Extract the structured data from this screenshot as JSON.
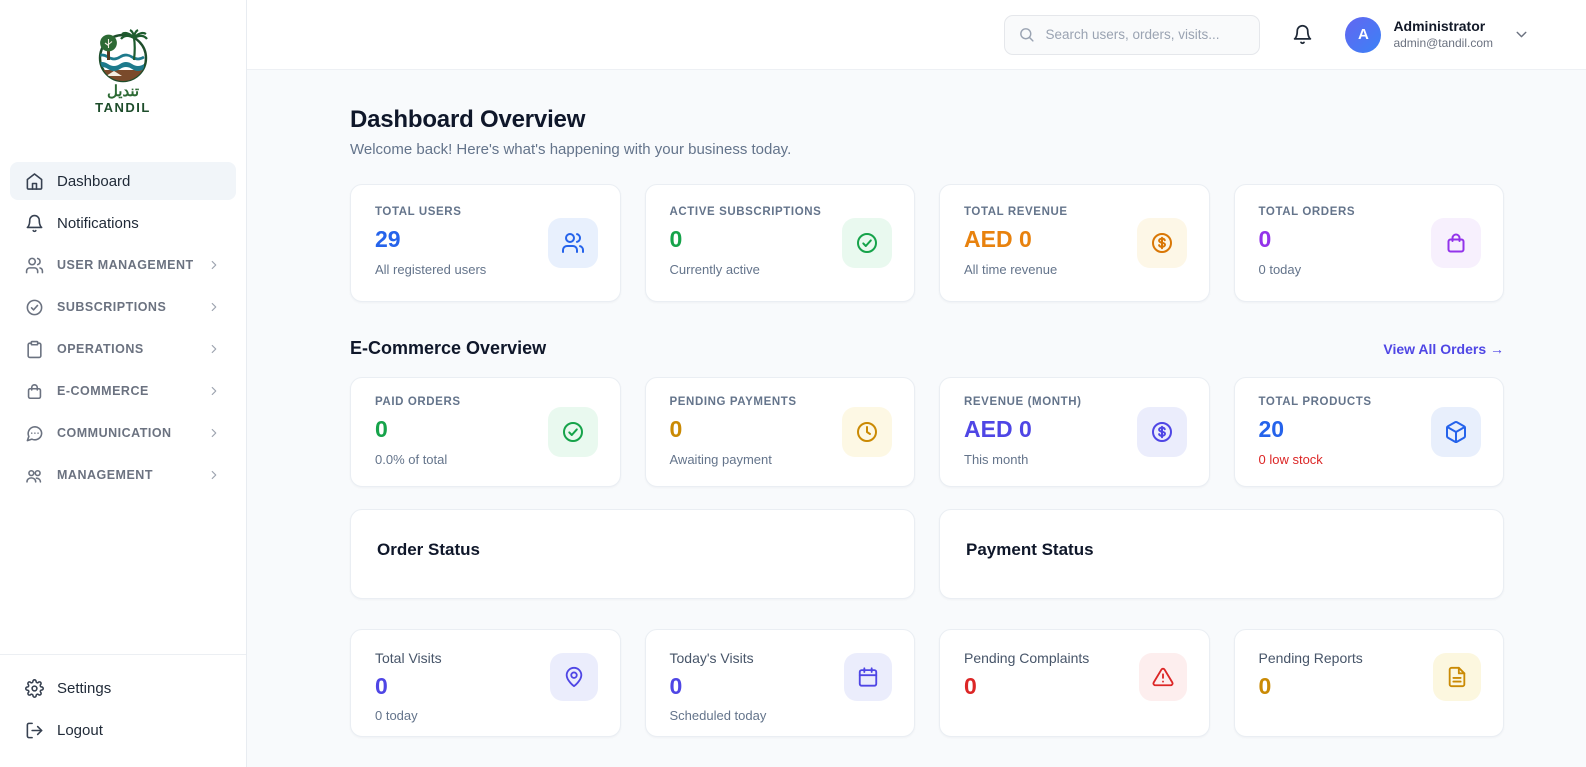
{
  "brand": {
    "name_en": "TANDIL",
    "name_ar": "تنديل"
  },
  "header": {
    "search_placeholder": "Search users, orders, visits...",
    "user": {
      "name": "Administrator",
      "email": "admin@tandil.com",
      "avatar_initial": "A"
    }
  },
  "sidebar": {
    "items": [
      {
        "label": "Dashboard",
        "icon": "home-icon",
        "active": true
      },
      {
        "label": "Notifications",
        "icon": "bell-icon",
        "active": false
      },
      {
        "label": "USER MANAGEMENT",
        "icon": "users-icon",
        "expandable": true
      },
      {
        "label": "SUBSCRIPTIONS",
        "icon": "check-circle-icon",
        "expandable": true
      },
      {
        "label": "OPERATIONS",
        "icon": "clipboard-icon",
        "expandable": true
      },
      {
        "label": "E-COMMERCE",
        "icon": "shopping-bag-icon",
        "expandable": true
      },
      {
        "label": "COMMUNICATION",
        "icon": "chat-icon",
        "expandable": true
      },
      {
        "label": "MANAGEMENT",
        "icon": "team-icon",
        "expandable": true
      }
    ],
    "footer_items": [
      {
        "label": "Settings",
        "icon": "gear-icon"
      },
      {
        "label": "Logout",
        "icon": "logout-icon"
      }
    ]
  },
  "page": {
    "title": "Dashboard Overview",
    "subtitle": "Welcome back! Here's what's happening with your business today."
  },
  "overview_cards": [
    {
      "label": "TOTAL USERS",
      "value": "29",
      "sub": "All registered users",
      "icon": "users-icon",
      "value_color": "#2563eb",
      "icon_color": "#2563eb",
      "icon_bg": "#e8f0fd",
      "sub_color": "#64748b"
    },
    {
      "label": "ACTIVE SUBSCRIPTIONS",
      "value": "0",
      "sub": "Currently active",
      "icon": "check-circle-icon",
      "value_color": "#16a34a",
      "icon_color": "#16a34a",
      "icon_bg": "#e9f9ef",
      "sub_color": "#64748b"
    },
    {
      "label": "TOTAL REVENUE",
      "value": "AED 0",
      "sub": "All time revenue",
      "icon": "dollar-circle-icon",
      "value_color": "#e8820e",
      "icon_color": "#d97706",
      "icon_bg": "#fdf7e7",
      "sub_color": "#64748b"
    },
    {
      "label": "TOTAL ORDERS",
      "value": "0",
      "sub": "0 today",
      "icon": "shopping-bag-icon",
      "value_color": "#9333ea",
      "icon_color": "#9333ea",
      "icon_bg": "#f7f0fd",
      "sub_color": "#64748b"
    }
  ],
  "ecommerce_section": {
    "title": "E-Commerce Overview",
    "link_label": "View All Orders →",
    "link_color": "#4f46e5"
  },
  "ecommerce_cards": [
    {
      "label": "PAID ORDERS",
      "value": "0",
      "sub": "0.0% of total",
      "icon": "check-circle-icon",
      "value_color": "#16a34a",
      "icon_color": "#16a34a",
      "icon_bg": "#e9f9ef",
      "sub_color": "#64748b"
    },
    {
      "label": "PENDING PAYMENTS",
      "value": "0",
      "sub": "Awaiting payment",
      "icon": "clock-icon",
      "value_color": "#ca8a04",
      "icon_color": "#ca8a04",
      "icon_bg": "#fdf8e4",
      "sub_color": "#64748b"
    },
    {
      "label": "REVENUE (MONTH)",
      "value": "AED 0",
      "sub": "This month",
      "icon": "dollar-circle-icon",
      "value_color": "#4f46e5",
      "icon_color": "#4f46e5",
      "icon_bg": "#ebedfc",
      "sub_color": "#64748b"
    },
    {
      "label": "TOTAL PRODUCTS",
      "value": "20",
      "sub": "0 low stock",
      "icon": "package-icon",
      "value_color": "#2563eb",
      "icon_color": "#2563eb",
      "icon_bg": "#e8effc",
      "sub_color": "#dc2626"
    }
  ],
  "panels": [
    {
      "title": "Order Status"
    },
    {
      "title": "Payment Status"
    }
  ],
  "activity_cards": [
    {
      "label": "Total Visits",
      "value": "0",
      "sub": "0 today",
      "icon": "map-pin-icon",
      "value_color": "#4f46e5",
      "icon_color": "#4f46e5",
      "icon_bg": "#ebedfc",
      "sub_color": "#64748b"
    },
    {
      "label": "Today's Visits",
      "value": "0",
      "sub": "Scheduled today",
      "icon": "calendar-icon",
      "value_color": "#4f46e5",
      "icon_color": "#4f46e5",
      "icon_bg": "#ebedfc",
      "sub_color": "#64748b"
    },
    {
      "label": "Pending Complaints",
      "value": "0",
      "sub": "",
      "icon": "alert-triangle-icon",
      "value_color": "#dc2626",
      "icon_color": "#dc2626",
      "icon_bg": "#fdeeee",
      "sub_color": "#64748b"
    },
    {
      "label": "Pending Reports",
      "value": "0",
      "sub": "",
      "icon": "file-text-icon",
      "value_color": "#ca8a04",
      "icon_color": "#ca8a04",
      "icon_bg": "#fcf7df",
      "sub_color": "#64748b"
    }
  ]
}
